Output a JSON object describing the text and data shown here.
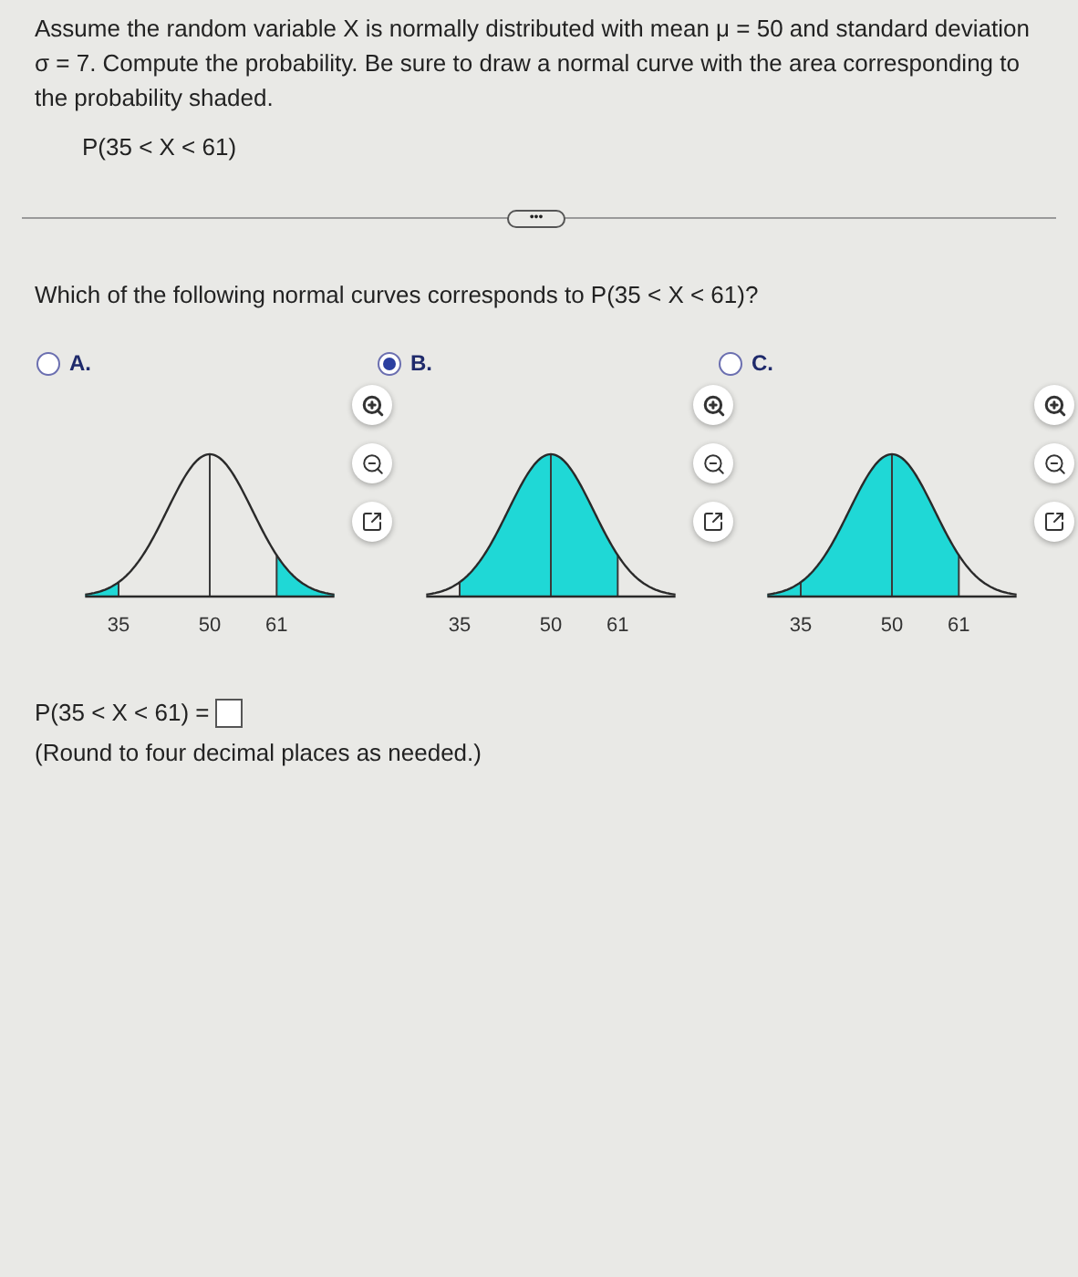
{
  "problem": {
    "text": "Assume the random variable X is normally distributed with mean μ = 50 and standard deviation σ = 7. Compute the probability. Be sure to draw a normal curve with the area corresponding to the probability shaded.",
    "expression": "P(35 < X < 61)"
  },
  "expand_button": "•••",
  "question": "Which of the following normal curves corresponds to P(35 < X < 61)?",
  "options": [
    {
      "label": "A.",
      "selected": false,
      "kind": "tails",
      "ticks": [
        "35",
        "50",
        "61"
      ]
    },
    {
      "label": "B.",
      "selected": true,
      "kind": "between",
      "ticks": [
        "35",
        "50",
        "61"
      ]
    },
    {
      "label": "C.",
      "selected": false,
      "kind": "below",
      "ticks": [
        "35",
        "50",
        "61"
      ]
    }
  ],
  "answer": {
    "prefix": "P(35 < X < 61) =",
    "note": "(Round to four decimal places as needed.)"
  }
}
